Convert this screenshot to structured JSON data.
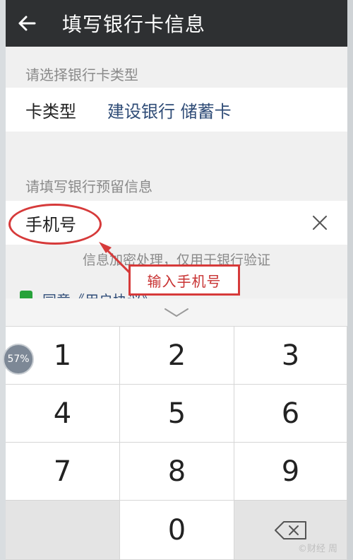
{
  "header": {
    "title": "填写银行卡信息"
  },
  "card_section": {
    "label": "请选择银行卡类型",
    "row_label": "卡类型",
    "row_value": "建设银行 储蓄卡"
  },
  "reserve_section": {
    "label": "请填写银行预留信息",
    "phone_placeholder": "手机号",
    "hint": "信息加密处理，仅用于银行验证"
  },
  "agreement": {
    "text": "同意《用户协议》"
  },
  "annotation": {
    "callout": "输入手机号"
  },
  "keyboard": {
    "keys": [
      "1",
      "2",
      "3",
      "4",
      "5",
      "6",
      "7",
      "8",
      "9",
      "",
      "0",
      "⌫"
    ]
  },
  "overlay_badge": "57%",
  "watermark": "©财经 周",
  "colors": {
    "topbar": "#2e3032",
    "accent_text": "#2f4c77",
    "annotation_red": "#d63a3a",
    "check_green": "#27a23a"
  }
}
